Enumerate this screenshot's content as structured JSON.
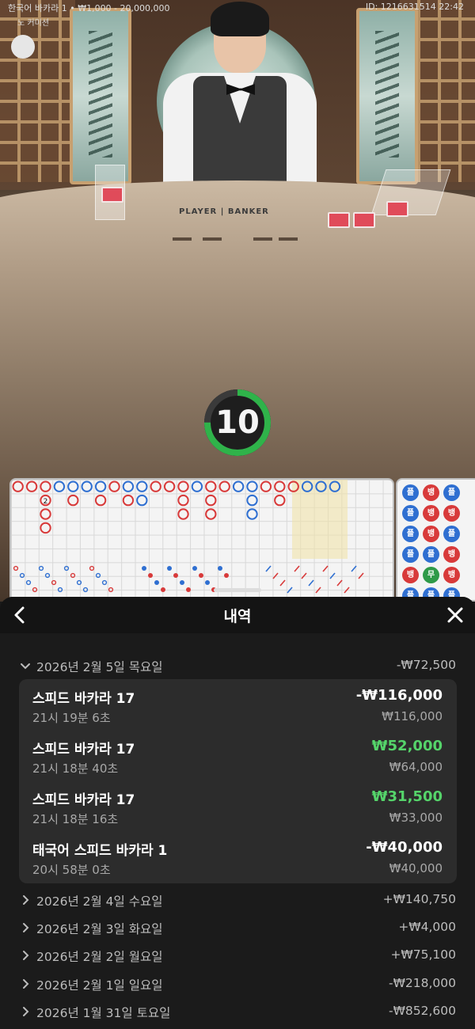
{
  "stream": {
    "table_info": "한국어 바카라 1 • ₩1,000 - 20,000,000",
    "id_time": "ID: 1216631514 22:42",
    "mode": "노 커미션",
    "table_label": "PLAYER | BANKER",
    "countdown": "10",
    "countdown_fraction": 0.75
  },
  "roadmap": {
    "side_beads": [
      [
        "플",
        "뱅",
        "플"
      ],
      [
        "플",
        "뱅",
        "뱅"
      ],
      [
        "플",
        "뱅",
        "플"
      ],
      [
        "플",
        "플",
        "뱅"
      ],
      [
        "뱅",
        "무",
        "뱅"
      ],
      [
        "플",
        "플",
        "플"
      ]
    ],
    "big_road_tie_count": "2"
  },
  "history": {
    "title": "내역",
    "days": [
      {
        "label": "2026년 2월 5일 목요일",
        "total": "-₩72,500",
        "expanded": true
      },
      {
        "label": "2026년 2월 4일 수요일",
        "total": "+₩140,750",
        "expanded": false
      },
      {
        "label": "2026년 2월 3일 화요일",
        "total": "+₩4,000",
        "expanded": false
      },
      {
        "label": "2026년 2월 2일 월요일",
        "total": "+₩75,100",
        "expanded": false
      },
      {
        "label": "2026년 2월 1일 일요일",
        "total": "-₩218,000",
        "expanded": false
      },
      {
        "label": "2026년 1월 31일 토요일",
        "total": "-₩852,600",
        "expanded": false
      }
    ],
    "transactions": [
      {
        "name": "스피드 바카라 17",
        "time": "21시 19분 6초",
        "amount": "-₩116,000",
        "stake": "₩116,000",
        "win": false
      },
      {
        "name": "스피드 바카라 17",
        "time": "21시 18분 40초",
        "amount": "₩52,000",
        "stake": "₩64,000",
        "win": true
      },
      {
        "name": "스피드 바카라 17",
        "time": "21시 18분 16초",
        "amount": "₩31,500",
        "stake": "₩33,000",
        "win": true
      },
      {
        "name": "태국어 스피드 바카라 1",
        "time": "20시 58분 0초",
        "amount": "-₩40,000",
        "stake": "₩40,000",
        "win": false
      }
    ]
  },
  "colors": {
    "win_green": "#55d46a",
    "player_blue": "#2f6fd1",
    "banker_red": "#d83a3a",
    "tie_green": "#2f9a48",
    "timer_green": "#2fb34a"
  },
  "icons": {
    "back": "chevron-left-icon",
    "close": "close-icon",
    "expanded": "chevron-down-icon",
    "collapsed": "chevron-right-icon"
  }
}
